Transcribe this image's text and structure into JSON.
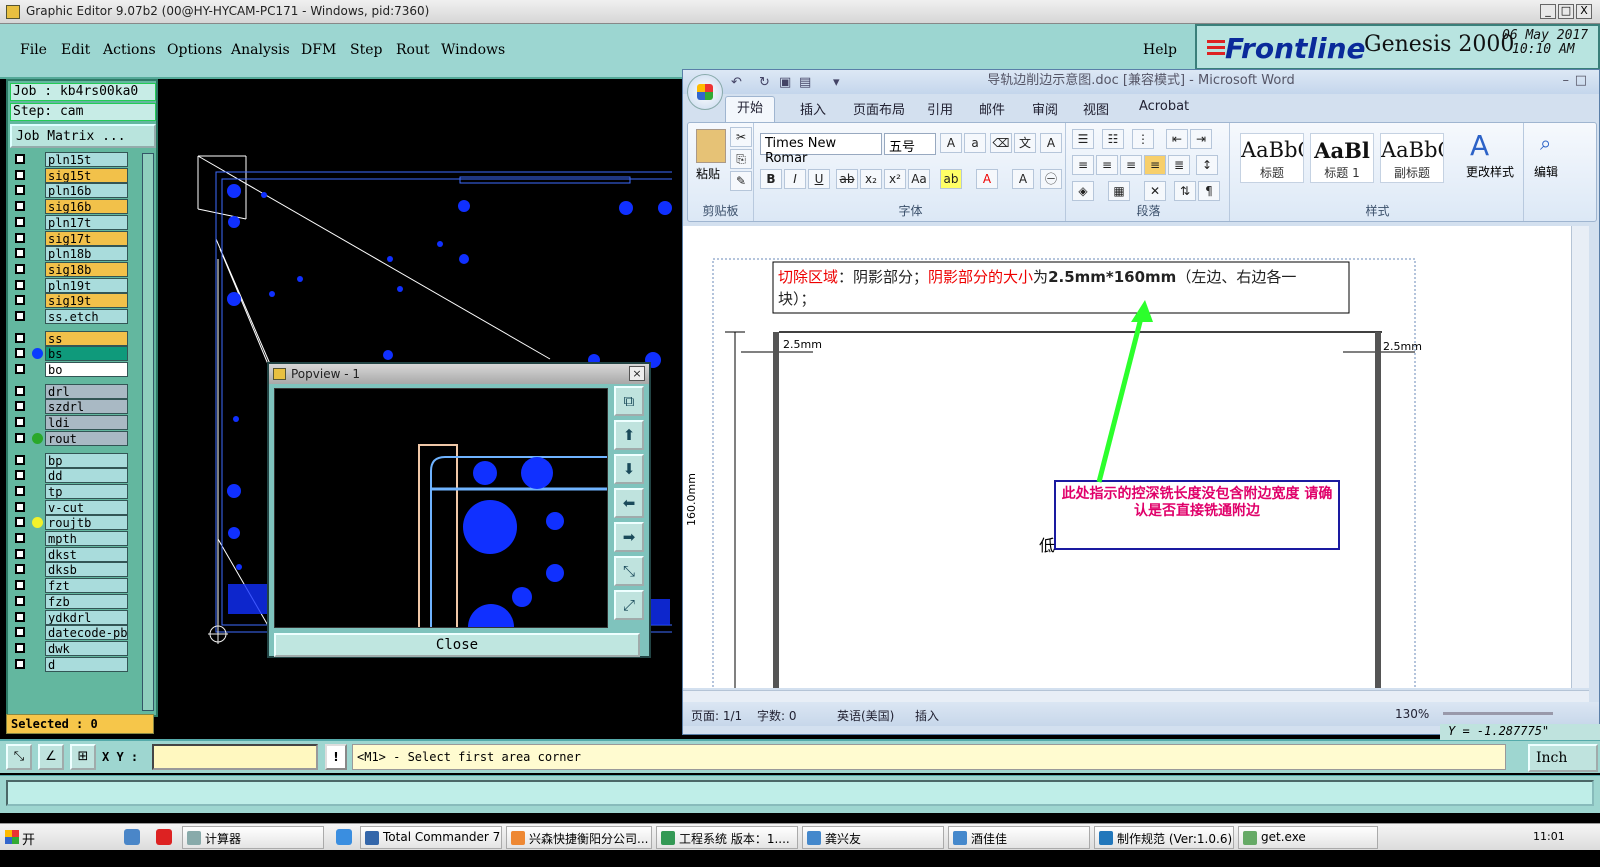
{
  "titlebar": {
    "text": "Graphic Editor 9.07b2 (00@HY-HYCAM-PC171 - Windows, pid:7360)",
    "min": "_",
    "max": "□",
    "close": "X"
  },
  "menu": {
    "items": [
      "File",
      "Edit",
      "Actions",
      "Options",
      "Analysis",
      "DFM",
      "Step",
      "Rout",
      "Windows"
    ],
    "help": "Help"
  },
  "brand": {
    "logo": "Frontline",
    "product": "Genesis 2000",
    "subtitle": "Graphic Editor",
    "date": "06 May 2017",
    "time": "10:10 AM"
  },
  "left": {
    "job": "Job : kb4rs00ka0",
    "step": "Step: cam",
    "job_matrix": "Job Matrix ...",
    "selected": "Selected : 0",
    "layers": [
      {
        "name": "pln15t",
        "color": "cyan"
      },
      {
        "name": "sig15t",
        "color": "orange"
      },
      {
        "name": "pln16b",
        "color": "cyan"
      },
      {
        "name": "sig16b",
        "color": "orange"
      },
      {
        "name": "pln17t",
        "color": "cyan"
      },
      {
        "name": "sig17t",
        "color": "orange"
      },
      {
        "name": "pln18b",
        "color": "cyan"
      },
      {
        "name": "sig18b",
        "color": "orange"
      },
      {
        "name": "pln19t",
        "color": "cyan"
      },
      {
        "name": "sig19t",
        "color": "orange"
      },
      {
        "name": "ss.etch",
        "color": "cyan"
      },
      {
        "name": "ss",
        "color": "orange"
      },
      {
        "name": "bs",
        "color": "green",
        "dot": "#0a3cff"
      },
      {
        "name": "bo",
        "color": "white"
      },
      {
        "name": "drl",
        "color": "gray"
      },
      {
        "name": "szdrl",
        "color": "gray"
      },
      {
        "name": "ldi",
        "color": "gray"
      },
      {
        "name": "rout",
        "color": "gray",
        "dot": "#2aa82a"
      },
      {
        "name": "bp",
        "color": "cyan"
      },
      {
        "name": "dd",
        "color": "cyan"
      },
      {
        "name": "tp",
        "color": "cyan"
      },
      {
        "name": "v-cut",
        "color": "cyan"
      },
      {
        "name": "roujtb",
        "color": "cyan",
        "dot": "#f2f22a"
      },
      {
        "name": "mpth",
        "color": "cyan"
      },
      {
        "name": "dkst",
        "color": "cyan"
      },
      {
        "name": "dksb",
        "color": "cyan"
      },
      {
        "name": "fzt",
        "color": "cyan"
      },
      {
        "name": "fzb",
        "color": "cyan"
      },
      {
        "name": "ydkdrl",
        "color": "cyan"
      },
      {
        "name": "datecode-pbe",
        "color": "cyan"
      },
      {
        "name": "dwk",
        "color": "cyan"
      },
      {
        "name": "d",
        "color": "cyan"
      }
    ]
  },
  "popview": {
    "title": "Popview - 1",
    "close_x": "×",
    "close_label": "Close"
  },
  "word": {
    "title": "导轨边削边示意图.doc [兼容模式] - Microsoft Word",
    "tabs": [
      "开始",
      "插入",
      "页面布局",
      "引用",
      "邮件",
      "审阅",
      "视图",
      "Acrobat"
    ],
    "groups": {
      "clipboard": "剪贴板",
      "font": "字体",
      "paragraph": "段落",
      "styles": "样式"
    },
    "paste": "粘贴",
    "font_name": "Times New Romar",
    "font_size": "五号",
    "styles": [
      {
        "preview": "AaBbC",
        "name": "标题"
      },
      {
        "preview": "AaBl",
        "name": "标题 1"
      },
      {
        "preview": "AaBbC",
        "name": "副标题"
      }
    ],
    "change_styles": "更改样式",
    "edit": "编辑",
    "doc": {
      "line1_a": "切除区域",
      "line1_b": "：阴影部分；",
      "line1_c": "阴影部分的大小",
      "line1_d": "为",
      "line1_e": "2.5mm*160mm",
      "line1_f": "（左边、右边各一",
      "line2": "块）；",
      "dim_left": "2.5mm",
      "dim_right": "2.5mm",
      "dim_height": "160.0mm",
      "note": "此处指示的控深铣长度没包含附边宽度    请确认是否直接铣通附边",
      "partial": "低"
    },
    "status": {
      "page": "页面: 1/1",
      "words": "字数: 0",
      "lang": "英语(美国)",
      "mode": "插入",
      "zoom": "130%"
    }
  },
  "cmd": {
    "xy_label": "X Y :",
    "prompt": "<M1> - Select first area corner",
    "unit": "Inch",
    "coord": "Y = -1.287775\""
  },
  "taskbar": {
    "start": "开始",
    "tasks": [
      "计算器",
      "Total Commander 7.0 ...",
      "兴森快捷衡阳分公司...",
      "工程系统  版本：1....",
      "龚兴友",
      "酒佳佳",
      "制作规范 (Ver:1.0.6)",
      "get.exe"
    ],
    "clock": "11:01"
  }
}
